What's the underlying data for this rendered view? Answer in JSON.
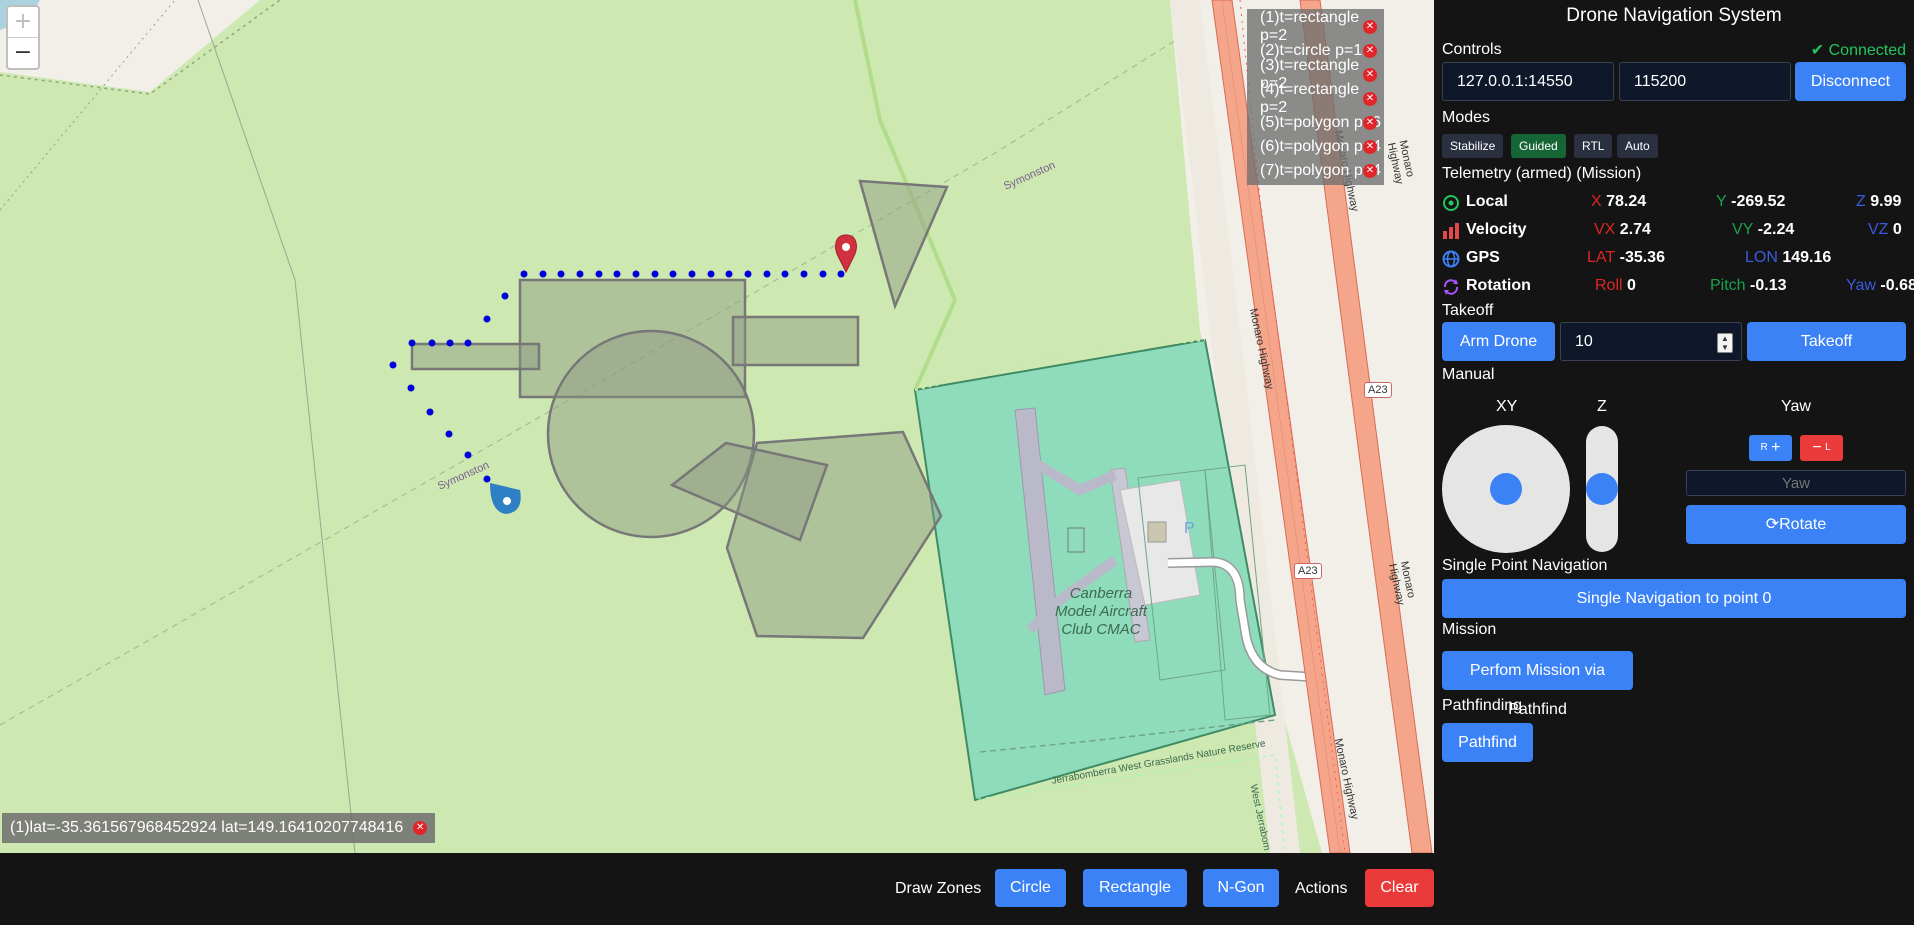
{
  "map": {
    "zoom_in": "+",
    "zoom_out": "−",
    "zones": [
      {
        "label": "(1)t=rectangle p=2"
      },
      {
        "label": "(2)t=circle p=1"
      },
      {
        "label": "(3)t=rectangle p=2"
      },
      {
        "label": "(4)t=rectangle p=2"
      },
      {
        "label": "(5)t=polygon p=6"
      },
      {
        "label": "(6)t=polygon p=4"
      },
      {
        "label": "(7)t=polygon p=4"
      }
    ],
    "waypoint": "(1)lat=-35.361567968452924 lat=149.16410207748416",
    "labels": {
      "symonston_1": "Symonston",
      "symonston_2": "Symonston",
      "monaro_1": "Monaro Highway",
      "monaro_2": "Monaro Highway",
      "monaro_3": "Monaro Highway",
      "monaro_4": "Monaro Highway",
      "monaro_5": "Monaro Highway",
      "a23_1": "A23",
      "a23_2": "A23",
      "club_1": "Canberra",
      "club_2": "Model Aircraft",
      "club_3": "Club CMAC",
      "parking": "P",
      "reserve": "Jerrabomberra West Grasslands Nature Reserve",
      "west": "West Jerrabom"
    }
  },
  "bottom_bar": {
    "draw_zones_label": "Draw Zones",
    "circle_button": "Circle",
    "rectangle_button": "Rectangle",
    "ngon_button": "N-Gon",
    "actions_label": "Actions",
    "clear_button": "Clear"
  },
  "panel": {
    "title": "Drone Navigation System",
    "controls": {
      "label": "Controls",
      "status": "Connected",
      "address": "127.0.0.1:14550",
      "baud": "115200",
      "disconnect_button": "Disconnect"
    },
    "modes": {
      "label": "Modes",
      "items": [
        "Stabilize",
        "Guided",
        "RTL",
        "Auto"
      ],
      "active": "Guided"
    },
    "telemetry": {
      "label": "Telemetry (armed) (Mission)",
      "local": {
        "name": "Local",
        "x_key": "X",
        "x": "78.24",
        "y_key": "Y",
        "y": "-269.52",
        "z_key": "Z",
        "z": "9.99"
      },
      "velocity": {
        "name": "Velocity",
        "vx_key": "VX",
        "vx": "2.74",
        "vy_key": "VY",
        "vy": "-2.24",
        "vz_key": "VZ",
        "vz": "0"
      },
      "gps": {
        "name": "GPS",
        "lat_key": "LAT",
        "lat": "-35.36",
        "lon_key": "LON",
        "lon": "149.16"
      },
      "rotation": {
        "name": "Rotation",
        "roll_key": "Roll",
        "roll": "0",
        "pitch_key": "Pitch",
        "pitch": "-0.13",
        "yaw_key": "Yaw",
        "yaw": "-0.68"
      }
    },
    "takeoff": {
      "label": "Takeoff",
      "arm_button": "Arm Drone",
      "altitude": "10",
      "takeoff_button": "Takeoff"
    },
    "manual": {
      "label": "Manual",
      "xy_label": "XY",
      "z_label": "Z",
      "yaw_label": "Yaw",
      "r_button": "R",
      "l_button": "L",
      "yaw_placeholder": "Yaw",
      "rotate_button": "Rotate"
    },
    "single_point": {
      "label": "Single Point Navigation",
      "button": "Single Navigation to point 0"
    },
    "mission": {
      "label": "Mission",
      "button": "Perfom Mission via Pathfind"
    },
    "pathfinding": {
      "label": "Pathfinding",
      "button": "Pathfind"
    }
  },
  "colors": {
    "accent": "#3b82f6",
    "danger": "#ea3a3a",
    "connected": "#22c55e",
    "map_grass": "#cde8b0",
    "airfield": "#8fdcbd",
    "highway": "#f4a58a"
  }
}
